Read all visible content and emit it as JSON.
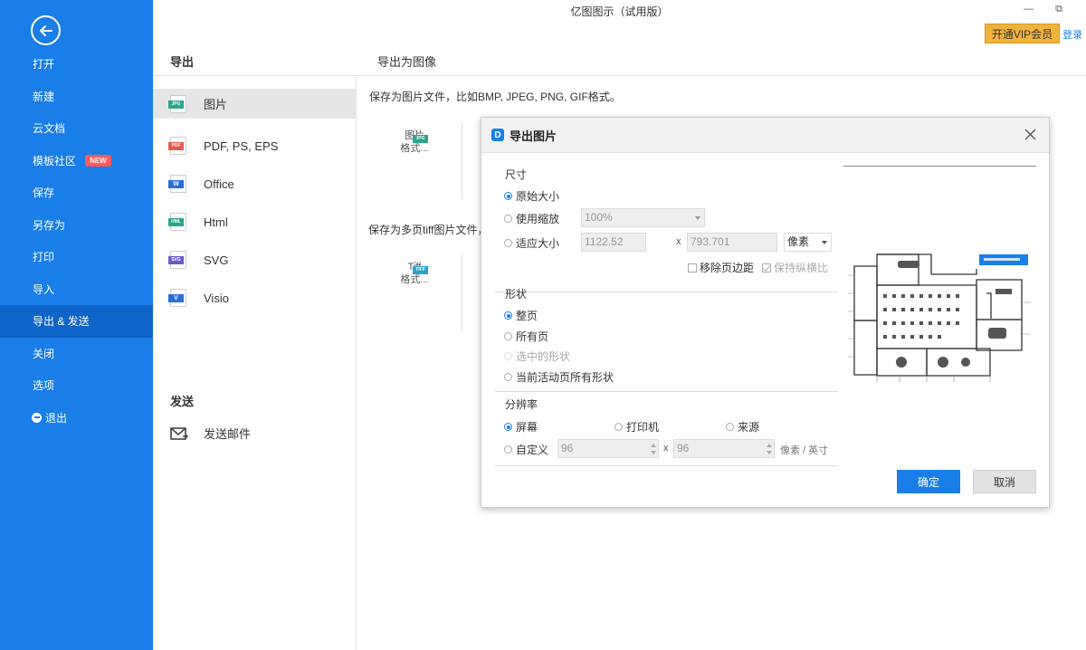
{
  "window": {
    "title": "亿图图示（试用版）",
    "vip_button": "开通VIP会员",
    "login": "登录",
    "minimize": "—",
    "restore": "⧉"
  },
  "sidebar": {
    "items": [
      {
        "label": "打开"
      },
      {
        "label": "新建"
      },
      {
        "label": "云文档"
      },
      {
        "label": "模板社区",
        "badge": "NEW"
      },
      {
        "label": "保存"
      },
      {
        "label": "另存为"
      },
      {
        "label": "打印"
      },
      {
        "label": "导入"
      },
      {
        "label": "导出 & 发送",
        "active": true
      },
      {
        "label": "关闭"
      },
      {
        "label": "选项"
      },
      {
        "label": "退出"
      }
    ]
  },
  "export_panel": {
    "header": "导出",
    "formats": [
      {
        "label": "图片",
        "icon": "jpg-file-icon",
        "tag": "JPG",
        "color": "#2aa58c"
      },
      {
        "label": "PDF, PS, EPS",
        "icon": "pdf-file-icon",
        "tag": "PDF",
        "color": "#e55a4e"
      },
      {
        "label": "Office",
        "icon": "word-file-icon",
        "tag": "W",
        "color": "#2b6fd6"
      },
      {
        "label": "Html",
        "icon": "html-file-icon",
        "tag": "HML",
        "color": "#2aa58c"
      },
      {
        "label": "SVG",
        "icon": "svg-file-icon",
        "tag": "SVG",
        "color": "#6a5acd"
      },
      {
        "label": "Visio",
        "icon": "visio-file-icon",
        "tag": "V",
        "color": "#2b6fd6"
      }
    ],
    "send_header": "发送",
    "send_mail": "发送邮件"
  },
  "content": {
    "header": "导出为图像",
    "desc1": "保存为图片文件，比如BMP, JPEG, PNG, GIF格式。",
    "tile1": {
      "tag": "JPG",
      "line1": "图片",
      "line2": "格式..."
    },
    "desc2": "保存为多页tiff图片文件，",
    "tile2": {
      "tag": "TIFF",
      "line1": "Tiff",
      "line2": "格式..."
    }
  },
  "dialog": {
    "title": "导出图片",
    "size_section": "尺寸",
    "opt_original": "原始大小",
    "opt_zoom": "使用缩放",
    "zoom_value": "100%",
    "opt_fit": "适应大小",
    "width_value": "1122.52",
    "height_value": "793.701",
    "times": "x",
    "unit": "像素",
    "remove_margin": "移除页边距",
    "keep_ratio": "保持纵横比",
    "shape_section": "形状",
    "opt_whole_page": "整页",
    "opt_all_pages": "所有页",
    "opt_selected": "选中的形状",
    "opt_current_page_shapes": "当前活动页所有形状",
    "resolution_section": "分辨率",
    "opt_screen": "屏幕",
    "opt_printer": "打印机",
    "opt_source": "来源",
    "opt_custom": "自定义",
    "dpi_x": "96",
    "dpi_y": "96",
    "dpi_unit": "像素 / 英寸",
    "ok": "确定",
    "cancel": "取消"
  }
}
